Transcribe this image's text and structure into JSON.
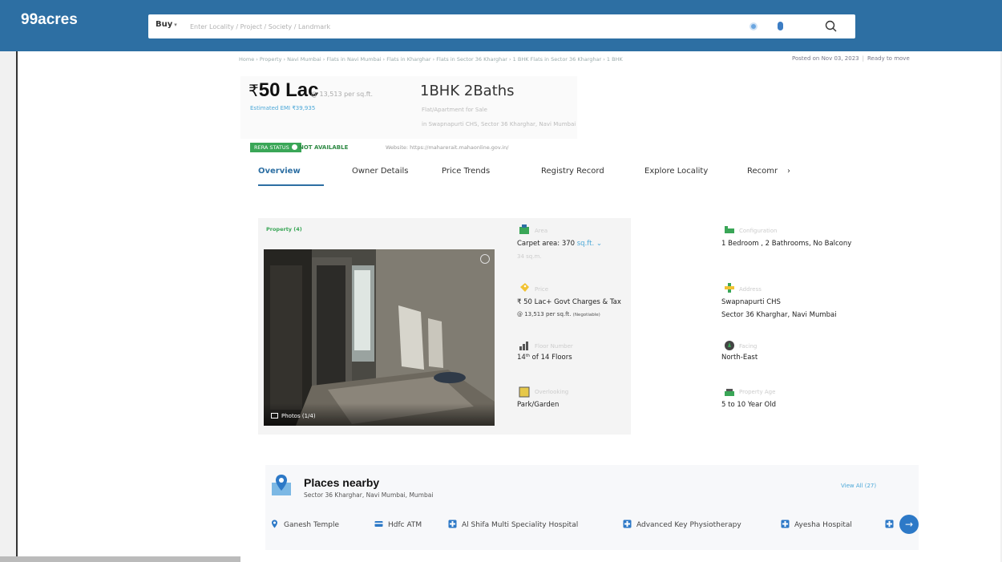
{
  "header": {
    "logo": "99acres",
    "buy_label": "Buy",
    "search_placeholder": "Enter Locality / Project / Society / Landmark"
  },
  "breadcrumb": "Home › Property › Navi Mumbai › Flats in Navi Mumbai › Flats in Kharghar › Flats in Sector 36 Kharghar › 1 BHK Flats in Sector 36 Kharghar › 1 BHK",
  "posted": {
    "date": "Posted on Nov 03, 2023",
    "status": "Ready to move"
  },
  "listing": {
    "price_symbol": "₹",
    "price": "50 Lac",
    "per_sqft": "@ 13,513 per sq.ft.",
    "emi": "Estimated EMI ₹39,935",
    "config": "1BHK 2Baths",
    "sub_line1": "Flat/Apartment for Sale",
    "sub_line2": "in Swapnapurti CHS, Sector 36 Kharghar, Navi Mumbai"
  },
  "rera": {
    "badge": "RERA STATUS",
    "status": "NOT AVAILABLE",
    "website": "Website: https://maharerait.mahaonline.gov.in/"
  },
  "tabs": [
    {
      "label": "Overview"
    },
    {
      "label": "Owner Details"
    },
    {
      "label": "Price Trends"
    },
    {
      "label": "Registry Record"
    },
    {
      "label": "Explore Locality"
    },
    {
      "label": "Recomr"
    }
  ],
  "tabs_more": "›",
  "gallery": {
    "label": "Property (4)",
    "photos_label": "Photos (1/4)"
  },
  "details": {
    "area_title": "Area",
    "area_value": "Carpet area: 370",
    "area_unit": "sq.ft.",
    "area_sub": "34 sq.m.",
    "config_title": "Configuration",
    "config_value": "1 Bedroom , 2 Bathrooms, No Balcony",
    "price_title": "Price",
    "price_value": "₹ 50 Lac+ Govt Charges & Tax",
    "price_sub": "@ 13,513 per sq.ft.",
    "price_nego": "(Negotiable)",
    "address_title": "Address",
    "address_value": "Swapnapurti CHS",
    "address_sub": "Sector 36 Kharghar, Navi Mumbai",
    "floor_title": "Floor Number",
    "floor_value": "14",
    "floor_sup": "th",
    "floor_rest": " of 14 Floors",
    "facing_title": "Facing",
    "facing_value": "North-East",
    "overlooking_title": "Overlooking",
    "overlooking_value": "Park/Garden",
    "age_title": "Property Age",
    "age_value": "5 to 10 Year Old"
  },
  "nearby": {
    "title": "Places nearby",
    "subtitle": "Sector 36 Kharghar, Navi Mumbai, Mumbai",
    "view_all": "View All (27)",
    "items": [
      {
        "label": "Ganesh Temple"
      },
      {
        "label": "Hdfc ATM"
      },
      {
        "label": "Al Shifa Multi Speciality Hospital"
      },
      {
        "label": "Advanced Key Physiotherapy"
      },
      {
        "label": "Ayesha Hospital"
      }
    ],
    "next": "→"
  },
  "colors": {
    "brand": "#2d6fa3",
    "rera_green": "#3aa657",
    "link": "#4ca8d8"
  }
}
